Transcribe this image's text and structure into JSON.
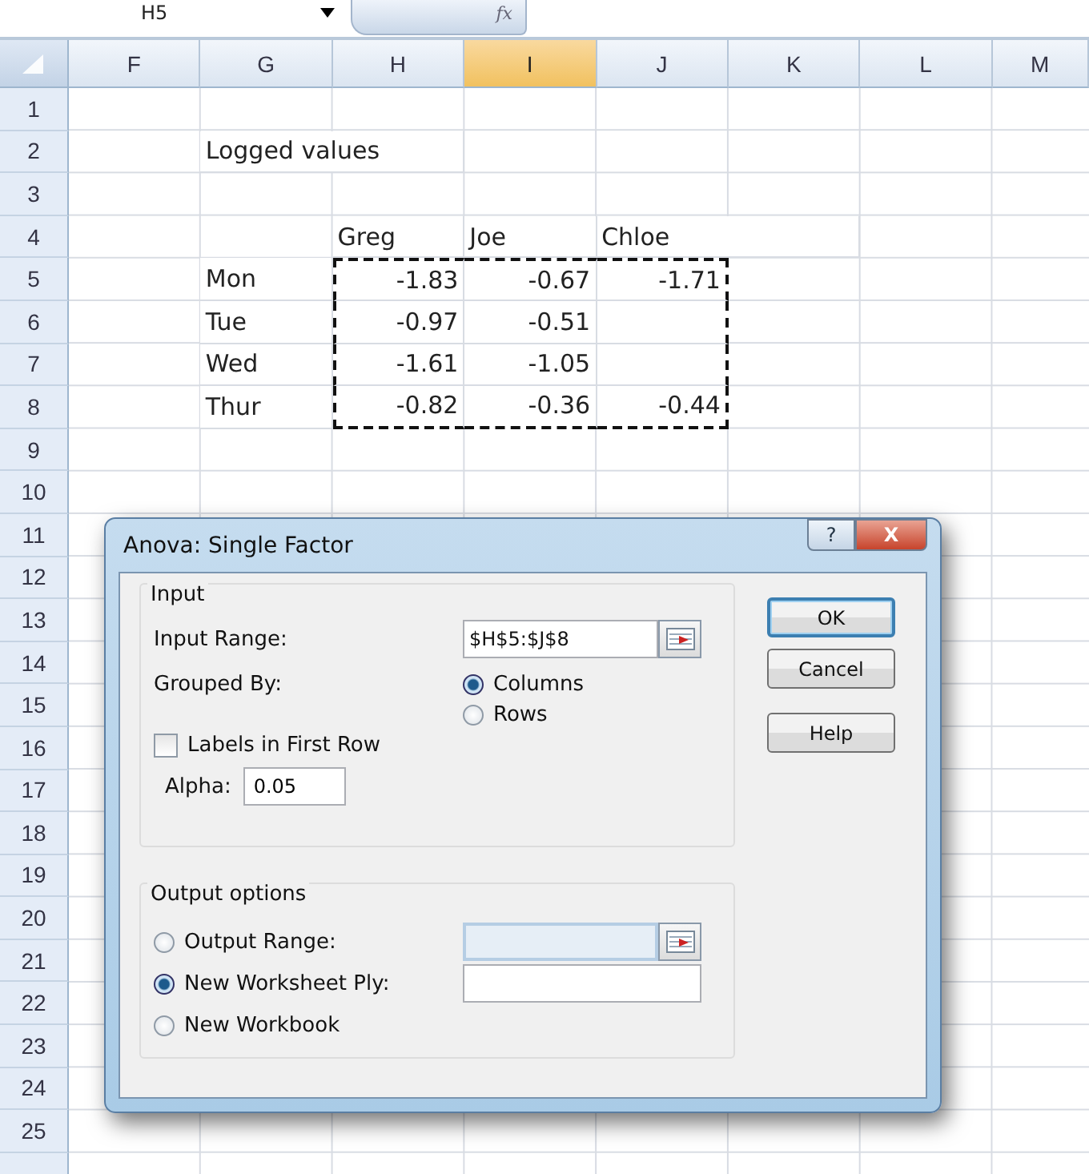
{
  "formula_bar": {
    "name_box": "H5",
    "formula_label": "fx"
  },
  "columns": [
    {
      "label": "F",
      "selected": false
    },
    {
      "label": "G",
      "selected": false
    },
    {
      "label": "H",
      "selected": false
    },
    {
      "label": "I",
      "selected": true
    },
    {
      "label": "J",
      "selected": false
    },
    {
      "label": "K",
      "selected": false
    },
    {
      "label": "L",
      "selected": false
    },
    {
      "label": "M",
      "selected": false
    }
  ],
  "rows": [
    {
      "label": "1"
    },
    {
      "label": "2",
      "cells": [
        {
          "kind": "empty"
        },
        {
          "kind": "text",
          "text": "Logged values"
        },
        {
          "kind": "empty"
        },
        {
          "kind": "empty"
        },
        {
          "kind": "empty"
        },
        {
          "kind": "empty"
        },
        {
          "kind": "empty"
        },
        {
          "kind": "empty"
        }
      ]
    },
    {
      "label": "3"
    },
    {
      "label": "4",
      "cells": [
        {
          "kind": "empty"
        },
        {
          "kind": "empty"
        },
        {
          "kind": "text",
          "text": "Greg"
        },
        {
          "kind": "text",
          "text": "Joe"
        },
        {
          "kind": "text",
          "text": "Chloe"
        },
        {
          "kind": "empty"
        },
        {
          "kind": "empty"
        },
        {
          "kind": "empty"
        }
      ]
    },
    {
      "label": "5",
      "cells": [
        {
          "kind": "empty"
        },
        {
          "kind": "text",
          "text": "Mon"
        },
        {
          "kind": "number",
          "text": "-1.83",
          "copied": true
        },
        {
          "kind": "number",
          "text": "-0.67",
          "copied": true
        },
        {
          "kind": "number",
          "text": "-1.71",
          "copied": true
        },
        {
          "kind": "empty"
        },
        {
          "kind": "empty"
        },
        {
          "kind": "empty"
        }
      ]
    },
    {
      "label": "6",
      "cells": [
        {
          "kind": "empty"
        },
        {
          "kind": "text",
          "text": "Tue"
        },
        {
          "kind": "number",
          "text": "-0.97",
          "copied": true
        },
        {
          "kind": "number",
          "text": "-0.51",
          "copied": true
        },
        {
          "kind": "empty",
          "copied": true
        },
        {
          "kind": "empty"
        },
        {
          "kind": "empty"
        },
        {
          "kind": "empty"
        }
      ]
    },
    {
      "label": "7",
      "cells": [
        {
          "kind": "empty"
        },
        {
          "kind": "text",
          "text": "Wed"
        },
        {
          "kind": "number",
          "text": "-1.61",
          "copied": true
        },
        {
          "kind": "number",
          "text": "-1.05",
          "copied": true
        },
        {
          "kind": "empty",
          "copied": true
        },
        {
          "kind": "empty"
        },
        {
          "kind": "empty"
        },
        {
          "kind": "empty"
        }
      ]
    },
    {
      "label": "8",
      "cells": [
        {
          "kind": "empty"
        },
        {
          "kind": "text",
          "text": "Thur"
        },
        {
          "kind": "number",
          "text": "-0.82",
          "copied": true
        },
        {
          "kind": "number",
          "text": "-0.36",
          "copied": true
        },
        {
          "kind": "number",
          "text": "-0.44",
          "copied": true
        },
        {
          "kind": "empty"
        },
        {
          "kind": "empty"
        },
        {
          "kind": "empty"
        }
      ]
    },
    {
      "label": "9"
    },
    {
      "label": "10"
    },
    {
      "label": "11"
    },
    {
      "label": "12"
    },
    {
      "label": "13"
    },
    {
      "label": "14"
    },
    {
      "label": "15"
    },
    {
      "label": "16"
    },
    {
      "label": "17"
    },
    {
      "label": "18"
    },
    {
      "label": "19"
    },
    {
      "label": "20"
    },
    {
      "label": "21"
    },
    {
      "label": "22"
    },
    {
      "label": "23"
    },
    {
      "label": "24"
    },
    {
      "label": "25"
    }
  ],
  "dialog": {
    "title": "Anova: Single Factor",
    "help_button": "?",
    "close_button": "X",
    "input": {
      "title": "Input",
      "range_label": "Input Range:",
      "range_value": "$H$5:$J$8",
      "grouped_label": "Grouped By:",
      "grouped_options": [
        {
          "label": "Columns",
          "selected": true
        },
        {
          "label": "Rows",
          "selected": false
        }
      ],
      "labels_checkbox": {
        "label": "Labels in First Row",
        "checked": false
      },
      "alpha_label": "Alpha:",
      "alpha_value": "0.05"
    },
    "output": {
      "title": "Output options",
      "options": [
        {
          "label": "Output Range:",
          "selected": false,
          "kind": "range"
        },
        {
          "label": "New Worksheet Ply:",
          "selected": true,
          "kind": "text"
        },
        {
          "label": "New Workbook",
          "selected": false,
          "kind": "plain"
        }
      ]
    },
    "buttons": [
      {
        "label": "OK",
        "default": true
      },
      {
        "label": "Cancel",
        "default": false
      },
      {
        "label": "Help",
        "default": false
      }
    ]
  }
}
